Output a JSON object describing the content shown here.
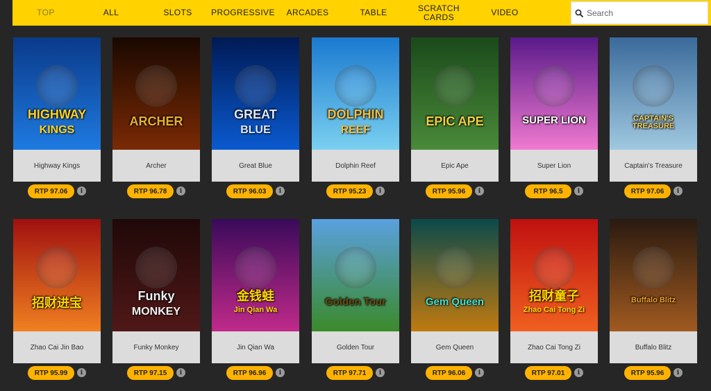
{
  "nav": {
    "items": [
      {
        "label": "TOP",
        "active": true
      },
      {
        "label": "ALL"
      },
      {
        "label": "SLOTS"
      },
      {
        "label": "PROGRESSIVE"
      },
      {
        "label": "ARCADES"
      },
      {
        "label": "TABLE"
      },
      {
        "label": "SCRATCH CARDS"
      },
      {
        "label": "VIDEO"
      }
    ],
    "search_placeholder": "Search",
    "colors": {
      "bar": "#ffd200",
      "active": "#8a7a2a"
    }
  },
  "games": [
    {
      "name": "Highway Kings",
      "rtp": "RTP 97.06",
      "art": "HIGHWAY",
      "sub": "KINGS",
      "icon": "truck-icon",
      "colors": [
        "#0a3a8a",
        "#1e7ae0"
      ],
      "artColor": "#ffd21e"
    },
    {
      "name": "Archer",
      "rtp": "RTP 96.78",
      "art": "ARCHER",
      "sub": "",
      "icon": "archer-icon",
      "colors": [
        "#1a0800",
        "#7a2a05"
      ],
      "artColor": "#e8b030"
    },
    {
      "name": "Great Blue",
      "rtp": "RTP 96.03",
      "art": "GREAT",
      "sub": "BLUE",
      "icon": "orca-icon",
      "colors": [
        "#001a55",
        "#0a5ad0"
      ],
      "artColor": "#dce8f8"
    },
    {
      "name": "Dolphin Reef",
      "rtp": "RTP 95.23",
      "art": "DOLPHIN",
      "sub": "REEF",
      "icon": "dolphin-icon",
      "colors": [
        "#1a7ad0",
        "#7ad0f0"
      ],
      "artColor": "#f0c040"
    },
    {
      "name": "Epic Ape",
      "rtp": "RTP 95.96",
      "art": "EPIC APE",
      "sub": "",
      "icon": "gorilla-icon",
      "colors": [
        "#1a4a1a",
        "#4a8a3a"
      ],
      "artColor": "#f0d040"
    },
    {
      "name": "Super Lion",
      "rtp": "RTP 96.5",
      "art": "SUPER LION",
      "sub": "",
      "icon": "lion-icon",
      "colors": [
        "#5a1a8a",
        "#f07ad0"
      ],
      "artColor": "#ffffff"
    },
    {
      "name": "Captain's Treasure",
      "rtp": "RTP 97.06",
      "art": "CAPTAIN'S TREASURE",
      "sub": "",
      "icon": "pirate-icon",
      "colors": [
        "#3a6a9a",
        "#a0c8e0"
      ],
      "artColor": "#f0d060"
    },
    {
      "name": "Zhao Cai Jin Bao",
      "rtp": "RTP 95.99",
      "art": "招财进宝",
      "sub": "",
      "icon": "god-of-wealth-icon",
      "colors": [
        "#a01010",
        "#f08020"
      ],
      "artColor": "#ffd700"
    },
    {
      "name": "Funky Monkey",
      "rtp": "RTP 97.15",
      "art": "Funky",
      "sub": "MONKEY",
      "icon": "monkey-icon",
      "colors": [
        "#200808",
        "#501818"
      ],
      "artColor": "#f0f0f0"
    },
    {
      "name": "Jin Qian Wa",
      "rtp": "RTP 96.96",
      "art": "金钱蛙",
      "sub": "Jin Qian Wa",
      "icon": "frog-icon",
      "colors": [
        "#3a0a5a",
        "#c02a8a"
      ],
      "artColor": "#ffd700"
    },
    {
      "name": "Golden Tour",
      "rtp": "RTP 97.71",
      "art": "Golden Tour",
      "sub": "",
      "icon": "golf-ball-icon",
      "colors": [
        "#5aa0e0",
        "#3a8a2a"
      ],
      "artColor": "#6a4a10"
    },
    {
      "name": "Gem Queen",
      "rtp": "RTP 96.06",
      "art": "Gem Queen",
      "sub": "",
      "icon": "queen-icon",
      "colors": [
        "#0a4a4a",
        "#c07a10"
      ],
      "artColor": "#40e0d0"
    },
    {
      "name": "Zhao Cai Tong Zi",
      "rtp": "RTP 97.01",
      "art": "招财童子",
      "sub": "Zhao Cai Tong Zi",
      "icon": "children-icon",
      "colors": [
        "#c01010",
        "#f06020"
      ],
      "artColor": "#ffd700"
    },
    {
      "name": "Buffalo Blitz",
      "rtp": "RTP 95.96",
      "art": "Buffalo Blitz",
      "sub": "",
      "icon": "buffalo-icon",
      "colors": [
        "#2a1a10",
        "#a05a20"
      ],
      "artColor": "#f0a020"
    }
  ],
  "rtp_badge_color": "#ffb300",
  "info_icon": "info-icon"
}
